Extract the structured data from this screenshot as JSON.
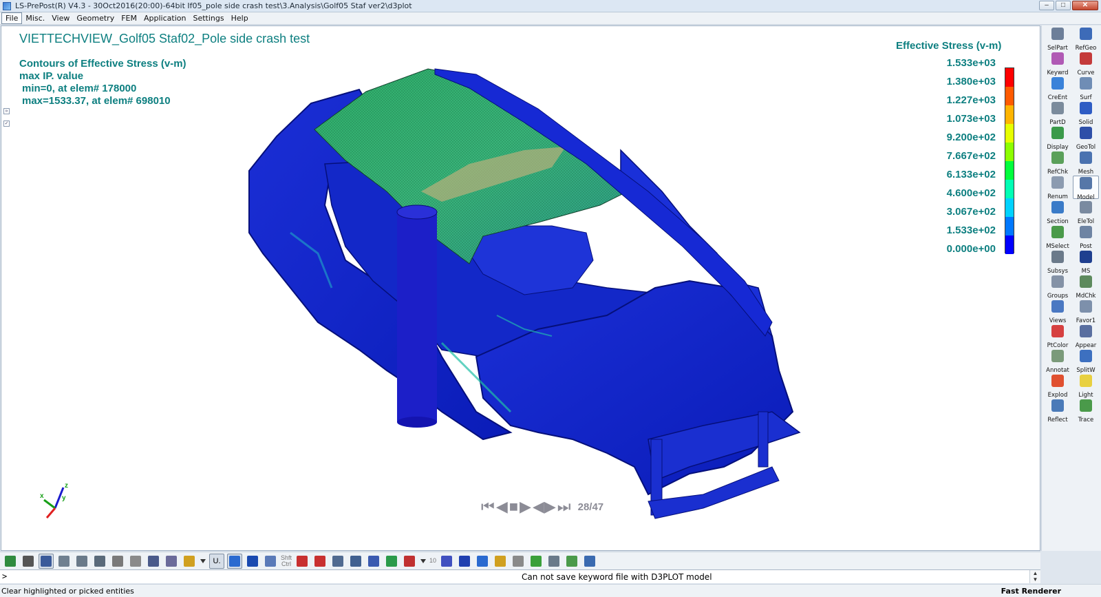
{
  "window": {
    "title": "LS-PrePost(R) V4.3 - 30Oct2016(20:00)-64bit If05_pole side crash test\\3.Analysis\\Golf05 Staf ver2\\d3plot",
    "min_glyph": "–",
    "max_glyph": "□",
    "close_glyph": "✕"
  },
  "menu": [
    "File",
    "Misc.",
    "View",
    "Geometry",
    "FEM",
    "Application",
    "Settings",
    "Help"
  ],
  "viewport": {
    "title": "VIETTECHVIEW_Golf05 Staf02_Pole side crash test",
    "contour_title": "Contours of Effective Stress (v-m)",
    "ip_line": "max IP. value",
    "min_line": " min=0, at elem# 178000",
    "max_line": " max=1533.37, at elem# 698010"
  },
  "legend": {
    "title": "Effective Stress (v-m)",
    "labels": [
      "1.533e+03",
      "1.380e+03",
      "1.227e+03",
      "1.073e+03",
      "9.200e+02",
      "7.667e+02",
      "6.133e+02",
      "4.600e+02",
      "3.067e+02",
      "1.533e+02",
      "0.000e+00"
    ],
    "colors": [
      "#ff0000",
      "#ff5a00",
      "#ffb400",
      "#e6ff00",
      "#8cff00",
      "#00ff3c",
      "#00ffb4",
      "#00d2ff",
      "#0078ff",
      "#0000ff"
    ]
  },
  "animation": {
    "frame_text": "28/47",
    "controls": [
      "first-frame",
      "prev-frame",
      "stop",
      "play",
      "play-loop",
      "last-frame"
    ]
  },
  "triad": {
    "x_label": "x",
    "y_label": "y",
    "z_label": "z"
  },
  "right_toolbar": [
    {
      "label": "SelPart",
      "icon": "selpart-icon",
      "color": "#6d7f99"
    },
    {
      "label": "RefGeo",
      "icon": "refgeo-icon",
      "color": "#3d6bb8"
    },
    {
      "label": "Keywrd",
      "icon": "keyword-icon",
      "color": "#b05ab5"
    },
    {
      "label": "Curve",
      "icon": "curve-icon",
      "color": "#c43b3b"
    },
    {
      "label": "CreEnt",
      "icon": "create-entity-icon",
      "color": "#3a82d9"
    },
    {
      "label": "Surf",
      "icon": "surface-icon",
      "color": "#6f8db5"
    },
    {
      "label": "PartD",
      "icon": "part-data-icon",
      "color": "#7b8b9c"
    },
    {
      "label": "Solid",
      "icon": "solid-icon",
      "color": "#2e5cc4"
    },
    {
      "label": "Display",
      "icon": "display-icon",
      "color": "#3b9a4a"
    },
    {
      "label": "GeoTol",
      "icon": "geotol-icon",
      "color": "#2e4fa8"
    },
    {
      "label": "RefChk",
      "icon": "refchk-icon",
      "color": "#5aa05a"
    },
    {
      "label": "Mesh",
      "icon": "mesh-icon",
      "color": "#4a72b0"
    },
    {
      "label": "Renum",
      "icon": "renumber-icon",
      "color": "#8c9bb0"
    },
    {
      "label": "Model",
      "icon": "model-icon",
      "color": "#5677a8"
    },
    {
      "label": "Section",
      "icon": "section-icon",
      "color": "#3a7bc8"
    },
    {
      "label": "EleTol",
      "icon": "eletol-icon",
      "color": "#7a8aa0"
    },
    {
      "label": "MSelect",
      "icon": "mselect-icon",
      "color": "#4a9a4a"
    },
    {
      "label": "Post",
      "icon": "post-icon",
      "color": "#6e84a3"
    },
    {
      "label": "Subsys",
      "icon": "subsystem-icon",
      "color": "#6b7a8a"
    },
    {
      "label": "MS",
      "icon": "ms-icon",
      "color": "#1f3f8f"
    },
    {
      "label": "Groups",
      "icon": "groups-icon",
      "color": "#8492a6"
    },
    {
      "label": "MdChk",
      "icon": "model-check-icon",
      "color": "#5d8a5d"
    },
    {
      "label": "Views",
      "icon": "views-icon",
      "color": "#4a78c2"
    },
    {
      "label": "Favor1",
      "icon": "favorite-icon",
      "color": "#7d90ab"
    },
    {
      "label": "PtColor",
      "icon": "part-color-icon",
      "color": "#d64040"
    },
    {
      "label": "Appear",
      "icon": "appearance-icon",
      "color": "#5a6fa0"
    },
    {
      "label": "Annotat",
      "icon": "annotate-icon",
      "color": "#7a9a7a"
    },
    {
      "label": "SplitW",
      "icon": "split-window-icon",
      "color": "#3d70c0"
    },
    {
      "label": "Explod",
      "icon": "explode-icon",
      "color": "#e05030"
    },
    {
      "label": "Light",
      "icon": "light-icon",
      "color": "#e8d040"
    },
    {
      "label": "Reflect",
      "icon": "reflect-icon",
      "color": "#4a7ab8"
    },
    {
      "label": "Trace",
      "icon": "trace-icon",
      "color": "#4a9a4a"
    }
  ],
  "bottom_toolbar": {
    "shft_ctrl": "Shft\nCtrl",
    "ten": "10",
    "u_label": "U.",
    "buttons": [
      "home-view-icon",
      "wireframe-icon",
      "shaded-icon",
      "hidden-icon",
      "feature-line-icon",
      "mesh-lines-icon",
      "outline-icon",
      "points-icon",
      "solid-shade-icon",
      "shrink-icon",
      "contour-fringe-icon",
      "dropdown-icon",
      "undo-label",
      "cube-front-icon",
      "cube-iso-icon",
      "frame-icon",
      "shft-ctrl-label",
      "pick-icon",
      "center-icon",
      "zoom-box-icon",
      "zoom-fit-icon",
      "rotate-icon",
      "globe-icon",
      "axis-icon",
      "dropdown-icon",
      "ten-label",
      "triad-icon",
      "part-icon",
      "home-icon",
      "annotate-icon",
      "checker-icon",
      "record-icon",
      "settings-icon",
      "settings2-icon",
      "graph-icon"
    ]
  },
  "command": {
    "prompt": ">",
    "message": "Can not save keyword file with D3PLOT model"
  },
  "status": {
    "left": "Clear highlighted or picked entities",
    "right": "Fast Renderer"
  }
}
